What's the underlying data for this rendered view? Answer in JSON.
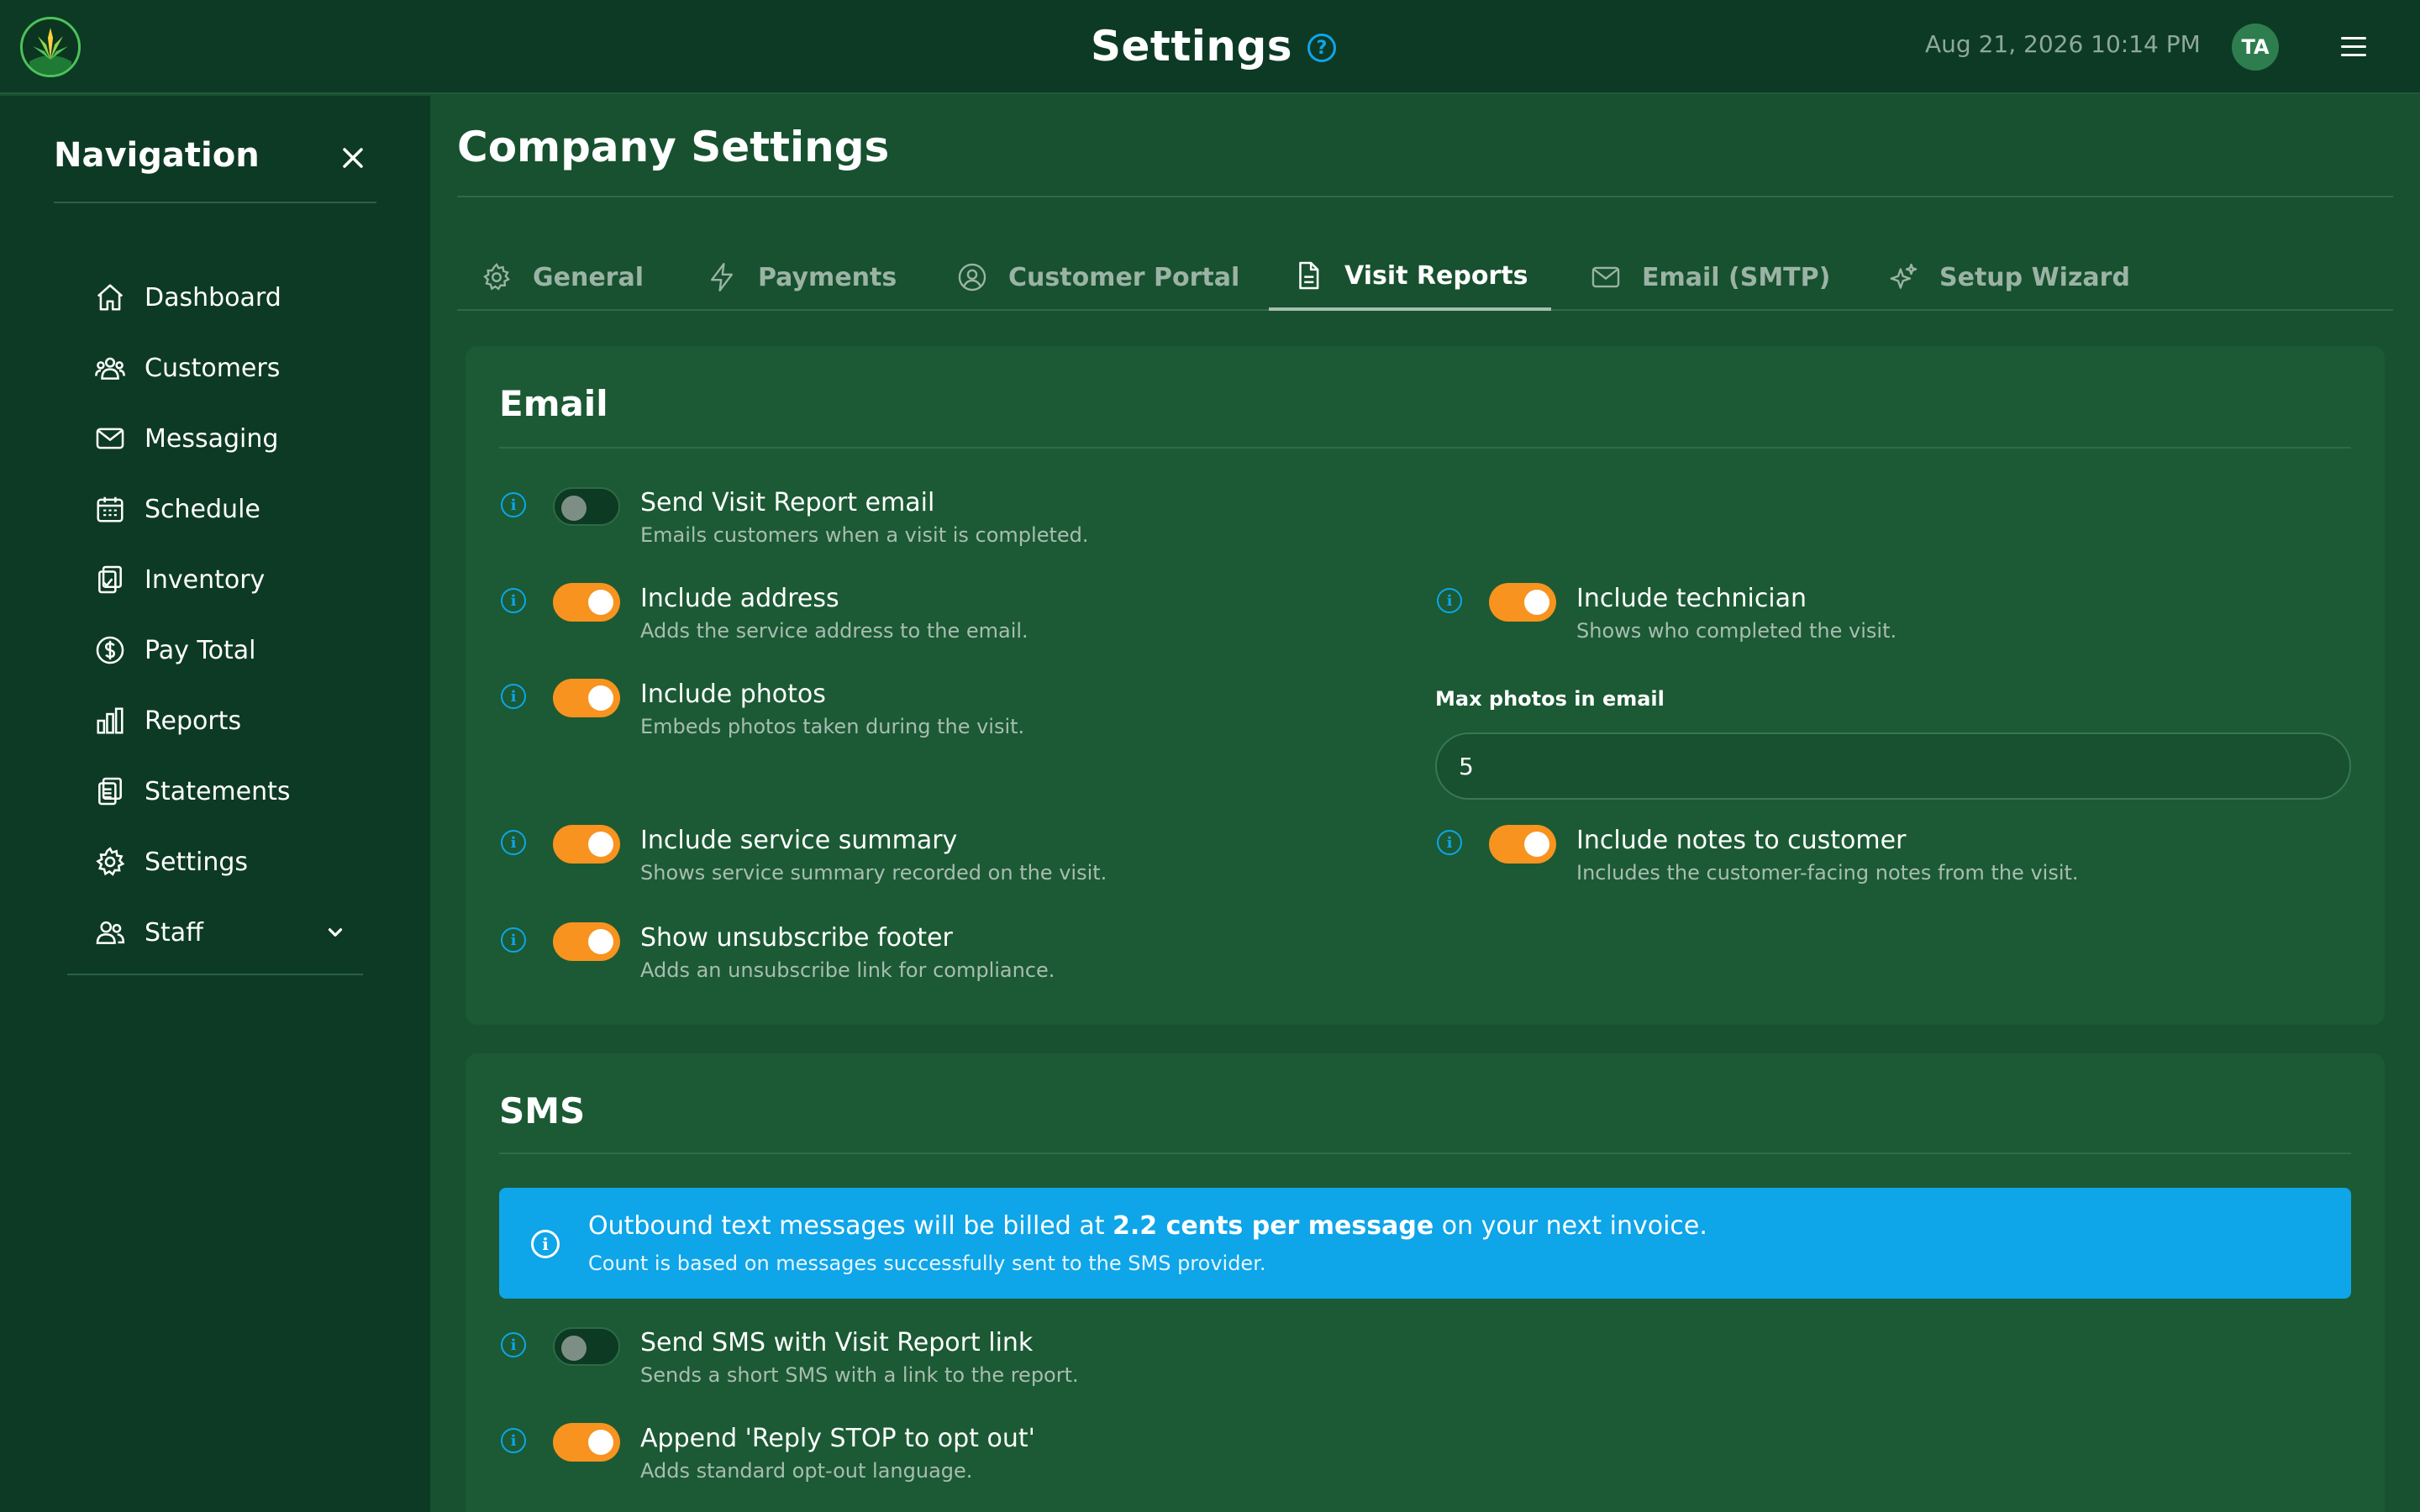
{
  "app": {
    "title": "Settings",
    "datetime": "Aug 21, 2026 10:14 PM",
    "avatar_initials": "TA",
    "accent": "#f7931e",
    "info_color": "#0ea5e9"
  },
  "sidebar": {
    "title": "Navigation",
    "items": [
      {
        "label": "Dashboard",
        "icon": "home-icon"
      },
      {
        "label": "Customers",
        "icon": "users-icon"
      },
      {
        "label": "Messaging",
        "icon": "mail-icon"
      },
      {
        "label": "Schedule",
        "icon": "calendar-icon"
      },
      {
        "label": "Inventory",
        "icon": "clipboard-check-icon"
      },
      {
        "label": "Pay Total",
        "icon": "dollar-circle-icon"
      },
      {
        "label": "Reports",
        "icon": "bar-chart-icon"
      },
      {
        "label": "Statements",
        "icon": "clipboard-list-icon"
      },
      {
        "label": "Settings",
        "icon": "gear-icon"
      },
      {
        "label": "Staff",
        "icon": "user-group-icon"
      }
    ]
  },
  "main": {
    "title": "Company Settings",
    "tabs": [
      {
        "label": "General",
        "icon": "gear-icon"
      },
      {
        "label": "Payments",
        "icon": "lightning-icon"
      },
      {
        "label": "Customer Portal",
        "icon": "user-circle-icon"
      },
      {
        "label": "Visit Reports",
        "icon": "document-icon",
        "active": true
      },
      {
        "label": "Email (SMTP)",
        "icon": "mail-icon"
      },
      {
        "label": "Setup Wizard",
        "icon": "sparkles-icon"
      }
    ]
  },
  "email": {
    "title": "Email",
    "send_report": {
      "label": "Send Visit Report email",
      "desc": "Emails customers when a visit is completed.",
      "on": false
    },
    "include_address": {
      "label": "Include address",
      "desc": "Adds the service address to the email.",
      "on": true
    },
    "include_technician": {
      "label": "Include technician",
      "desc": "Shows who completed the visit.",
      "on": true
    },
    "include_photos": {
      "label": "Include photos",
      "desc": "Embeds photos taken during the visit.",
      "on": true
    },
    "max_photos": {
      "label": "Max photos in email",
      "value": "5"
    },
    "include_summary": {
      "label": "Include service summary",
      "desc": "Shows service summary recorded on the visit.",
      "on": true
    },
    "include_notes": {
      "label": "Include notes to customer",
      "desc": "Includes the customer-facing notes from the visit.",
      "on": true
    },
    "unsubscribe_footer": {
      "label": "Show unsubscribe footer",
      "desc": "Adds an unsubscribe link for compliance.",
      "on": true
    }
  },
  "sms": {
    "title": "SMS",
    "banner": {
      "prefix": "Outbound text messages will be billed at ",
      "rate": "2.2 cents per message",
      "suffix": " on your next invoice.",
      "note": "Count is based on messages successfully sent to the SMS provider."
    },
    "send_link": {
      "label": "Send SMS with Visit Report link",
      "desc": "Sends a short SMS with a link to the report.",
      "on": false
    },
    "append_stop": {
      "label": "Append 'Reply STOP to opt out'",
      "desc": "Adds standard opt-out language.",
      "on": true
    }
  }
}
